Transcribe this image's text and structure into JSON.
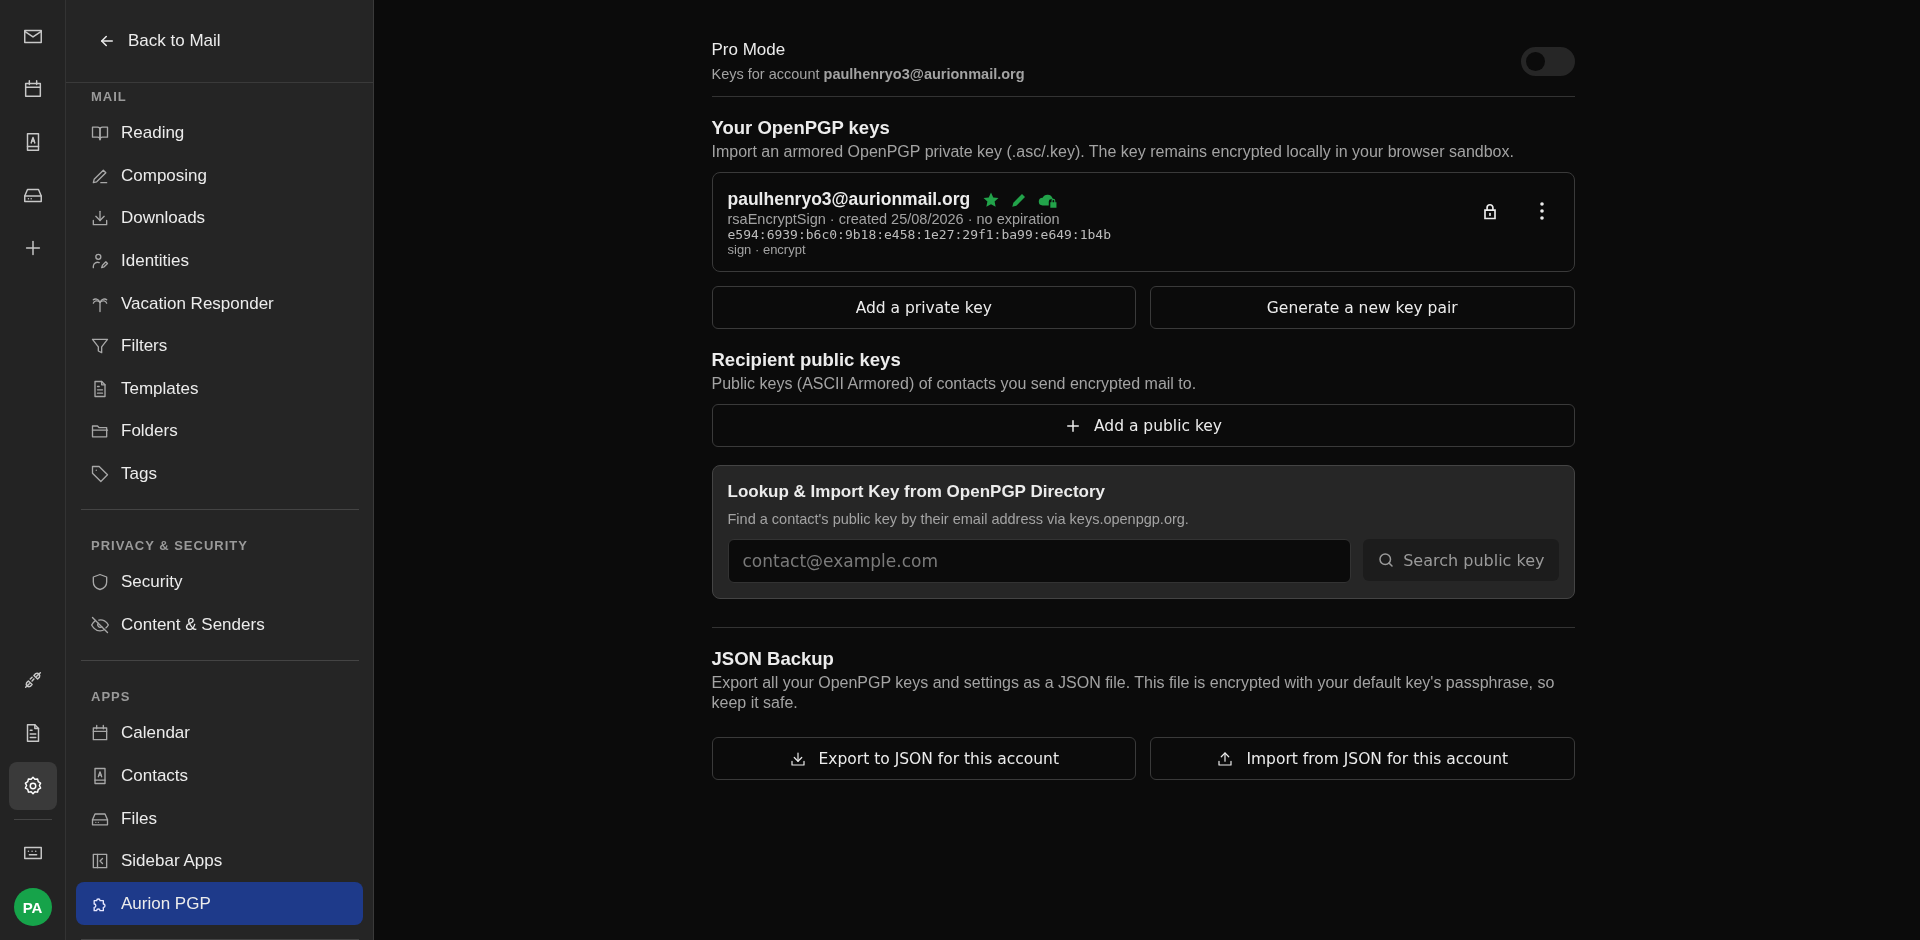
{
  "rail": {
    "top": [
      {
        "kind": "mail",
        "selected": false
      },
      {
        "kind": "calendar",
        "selected": false
      },
      {
        "kind": "contacts",
        "selected": false
      },
      {
        "kind": "drive",
        "selected": false
      },
      {
        "kind": "plus",
        "selected": false
      }
    ],
    "bottom": [
      {
        "kind": "plug",
        "selected": false
      },
      {
        "kind": "document",
        "selected": false
      },
      {
        "kind": "settings",
        "selected": true
      }
    ],
    "extra": [
      {
        "kind": "keyboard",
        "selected": false
      }
    ],
    "avatar": "PA"
  },
  "sidebar": {
    "back": "Back to Mail",
    "sections": [
      {
        "title": "MAIL",
        "items": [
          {
            "kind": "book",
            "label": "Reading",
            "selected": false
          },
          {
            "kind": "pen",
            "label": "Composing",
            "selected": false
          },
          {
            "kind": "download",
            "label": "Downloads",
            "selected": false
          },
          {
            "kind": "user-pen",
            "label": "Identities",
            "selected": false
          },
          {
            "kind": "palm",
            "label": "Vacation Responder",
            "selected": false
          },
          {
            "kind": "filter",
            "label": "Filters",
            "selected": false
          },
          {
            "kind": "document",
            "label": "Templates",
            "selected": false
          },
          {
            "kind": "folder",
            "label": "Folders",
            "selected": false
          },
          {
            "kind": "tag",
            "label": "Tags",
            "selected": false
          }
        ]
      },
      {
        "title": "PRIVACY & SECURITY",
        "items": [
          {
            "kind": "shield",
            "label": "Security",
            "selected": false
          },
          {
            "kind": "eye-off",
            "label": "Content & Senders",
            "selected": false
          }
        ]
      },
      {
        "title": "APPS",
        "items": [
          {
            "kind": "calendar",
            "label": "Calendar",
            "selected": false
          },
          {
            "kind": "contacts",
            "label": "Contacts",
            "selected": false
          },
          {
            "kind": "drive",
            "label": "Files",
            "selected": false
          },
          {
            "kind": "sidebar",
            "label": "Sidebar Apps",
            "selected": false
          },
          {
            "kind": "puzzle",
            "label": "Aurion PGP",
            "selected": true
          }
        ]
      }
    ]
  },
  "pro_mode": {
    "title": "Pro Mode",
    "subtitle": "Keys for account **paulhenryo3@aurionmail.org**",
    "on": false
  },
  "own_keys": {
    "title": "Your OpenPGP keys",
    "description": "Import an armored OpenPGP private key (.asc/.key). The key remains encrypted locally in your browser sandbox.",
    "keys": [
      {
        "email": "paulhenryo3@aurionmail.org",
        "meta": "rsaEncryptSign · created 25/08/2026 · no expiration",
        "fingerprint": "e594:6939:b6c0:9b18:e458:1e27:29f1:ba99:e649:1b4b",
        "usage": "sign · encrypt"
      }
    ],
    "buttons": [
      "Add a private key",
      "Generate a new key pair"
    ]
  },
  "public_keys": {
    "title": "Recipient public keys",
    "description": "Public keys (ASCII Armored) of contacts you send encrypted mail to.",
    "add_button": "Add a public key"
  },
  "lookup": {
    "title": "Lookup & Import Key from OpenPGP Directory",
    "description": "Find a contact's public key by their email address via keys.openpgp.org.",
    "placeholder": "contact@example.com",
    "button": "Search public key"
  },
  "backup": {
    "title": "JSON Backup",
    "description": "Export all your OpenPGP keys and settings as a JSON file. This file is encrypted with your default key's passphrase, so keep it safe.",
    "buttons": [
      {
        "kind": "download",
        "label": "Export to JSON for this account"
      },
      {
        "kind": "upload",
        "label": "Import from JSON for this account"
      }
    ]
  }
}
